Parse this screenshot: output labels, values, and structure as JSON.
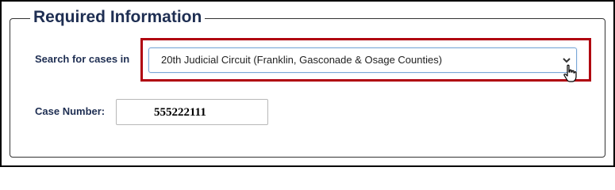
{
  "section": {
    "title": "Required Information"
  },
  "search": {
    "label": "Search for cases in",
    "selected_value": "20th Judicial Circuit (Franklin, Gasconade & Osage Counties)",
    "icon": "chevron-down-icon"
  },
  "case": {
    "label": "Case Number:",
    "value": "555222111"
  },
  "colors": {
    "highlight": "#b0000f",
    "heading": "#1e2e52"
  }
}
